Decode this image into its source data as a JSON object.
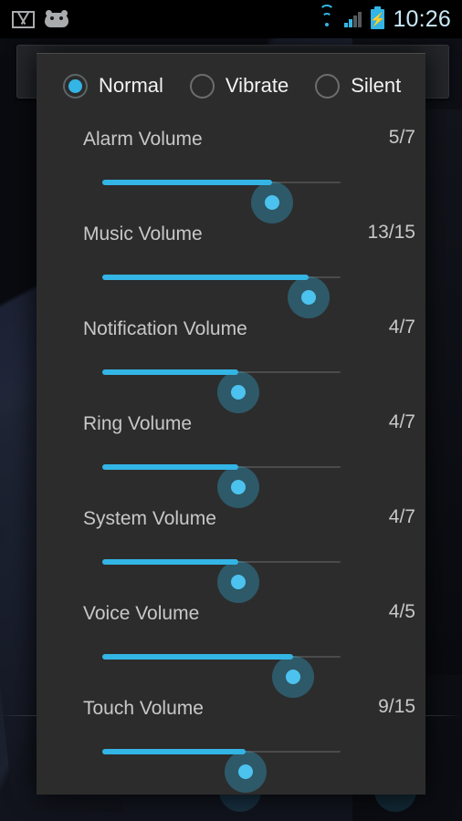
{
  "status_bar": {
    "left_icons": [
      {
        "name": "gmail-icon",
        "label": "Gmail"
      },
      {
        "name": "android-head-icon",
        "label": "System"
      }
    ],
    "right_icons": [
      {
        "name": "wifi-icon",
        "label": "Wi-Fi"
      },
      {
        "name": "cellular-signal-icon",
        "label": "Signal"
      },
      {
        "name": "battery-charging-icon",
        "label": "Battery charging"
      }
    ],
    "clock": "10:26",
    "accent_color": "#33b5e5",
    "icon_gray": "#a9abad"
  },
  "dialog": {
    "ringer_modes": [
      {
        "label": "Normal",
        "selected": true
      },
      {
        "label": "Vibrate",
        "selected": false
      },
      {
        "label": "Silent",
        "selected": false
      }
    ],
    "sliders": [
      {
        "label": "Alarm Volume",
        "value": 5,
        "max": 7,
        "value_text": "5/7"
      },
      {
        "label": "Music Volume",
        "value": 13,
        "max": 15,
        "value_text": "13/15"
      },
      {
        "label": "Notification Volume",
        "value": 4,
        "max": 7,
        "value_text": "4/7"
      },
      {
        "label": "Ring Volume",
        "value": 4,
        "max": 7,
        "value_text": "4/7"
      },
      {
        "label": "System Volume",
        "value": 4,
        "max": 7,
        "value_text": "4/7"
      },
      {
        "label": "Voice Volume",
        "value": 4,
        "max": 5,
        "value_text": "4/5"
      },
      {
        "label": "Touch Volume",
        "value": 9,
        "max": 15,
        "value_text": "9/15"
      }
    ],
    "accent_color": "#33b5e5",
    "background_color": "#2c2c2c",
    "label_color": "#c8c8c8"
  }
}
